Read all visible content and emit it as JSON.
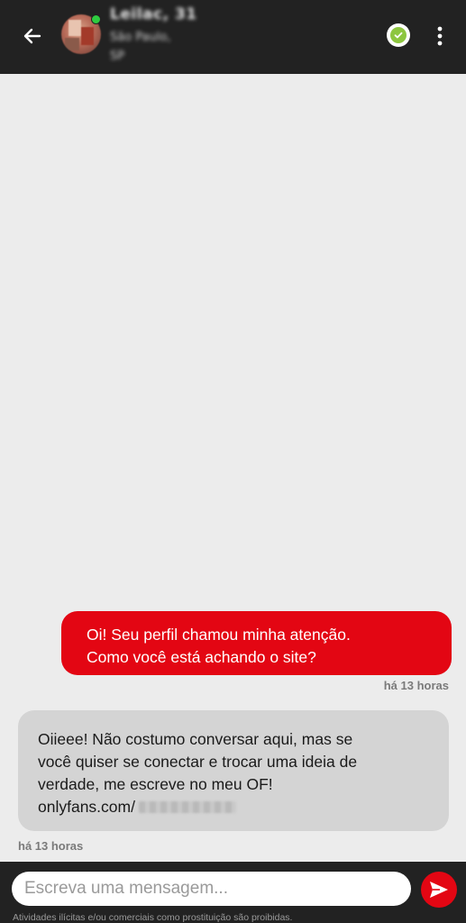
{
  "header": {
    "back_icon": "arrow-left-icon",
    "user_name": "Leilac, 31",
    "city": "São Paulo,",
    "state": "SP",
    "verified_icon": "verified-check-icon",
    "menu_icon": "more-vertical-icon",
    "online_status_color": "#2ecc40"
  },
  "messages": [
    {
      "direction": "outgoing",
      "lines": [
        "Oi! Seu perfil chamou minha atenção.",
        "Como você está achando o site?"
      ],
      "time": "há 13 horas"
    },
    {
      "direction": "incoming",
      "lines": [
        "Oiieee! Não costumo conversar aqui, mas se",
        "você quiser se conectar e trocar uma ideia de",
        "verdade, me escreve no meu OF!",
        "onlyfans.com/"
      ],
      "time": "há 13 horas"
    }
  ],
  "composer": {
    "placeholder": "Escreva uma mensagem...",
    "send_icon": "send-icon",
    "disclaimer": "Atividades ilícitas e/ou comerciais como prostituição são proibidas."
  },
  "colors": {
    "accent": "#e30613",
    "header_bg": "#222222",
    "chat_bg": "#ececec",
    "incoming_bubble": "#d4d4d4",
    "verified": "#8dc63f"
  }
}
